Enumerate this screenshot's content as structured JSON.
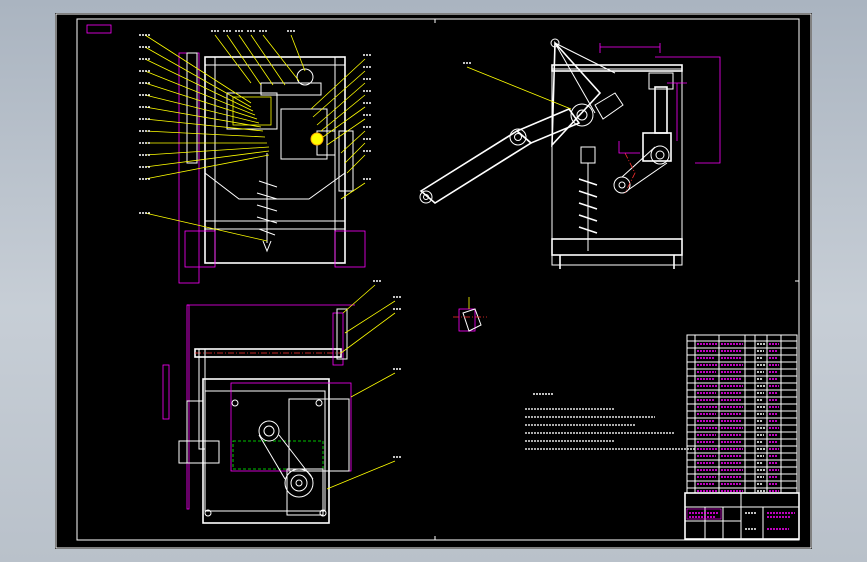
{
  "sheet": {
    "corner_label": "",
    "note_title": "",
    "note_lines": [
      "",
      "",
      "",
      "",
      "",
      ""
    ],
    "title_block": {
      "drawing_name": "",
      "drawing_number": ""
    }
  },
  "colors": {
    "background": "#000000",
    "outline": "#ffffff",
    "leader": "#ffff00",
    "dimension": "#ff00ff",
    "hidden": "#00ff00",
    "centerline": "#ff3030"
  }
}
